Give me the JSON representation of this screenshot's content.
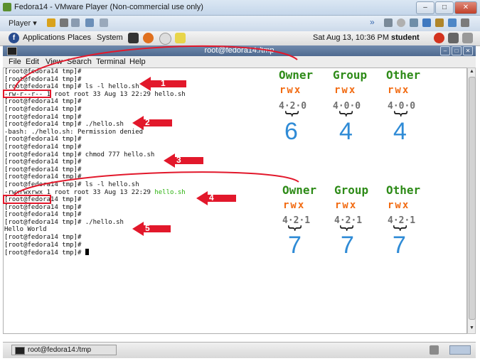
{
  "vm": {
    "title": "Fedora14 - VMware Player (Non-commercial use only)",
    "player": "Player",
    "player_caret": "▾"
  },
  "panel": {
    "applications": "Applications",
    "places": "Places",
    "system": "System",
    "clock": "Sat Aug 13, 10:36 PM",
    "user": "student"
  },
  "terminal": {
    "title": "root@fedora14:/tmp",
    "menu": [
      "File",
      "Edit",
      "View",
      "Search",
      "Terminal",
      "Help"
    ],
    "lines": [
      "[root@fedora14 tmp]#",
      "[root@fedora14 tmp]#",
      "[root@fedora14 tmp]# ls -l hello.sh",
      "-rw-r--r-- 1 root root 33 Aug 13 22:29 hello.sh",
      "[root@fedora14 tmp]#",
      "[root@fedora14 tmp]#",
      "[root@fedora14 tmp]#",
      "[root@fedora14 tmp]# ./hello.sh",
      "-bash: ./hello.sh: Permission denied",
      "[root@fedora14 tmp]#",
      "[root@fedora14 tmp]#",
      "[root@fedora14 tmp]# chmod 777 hello.sh",
      "[root@fedora14 tmp]#",
      "[root@fedora14 tmp]#",
      "[root@fedora14 tmp]#",
      "[root@fedora14 tmp]# ls -l hello.sh",
      "-rwxrwxrwx 1 root root 33 Aug 13 22:29 ",
      "[root@fedora14 tmp]#",
      "[root@fedora14 tmp]#",
      "[root@fedora14 tmp]#",
      "[root@fedora14 tmp]# ./hello.sh",
      "Hello World",
      "[root@fedora14 tmp]#",
      "[root@fedora14 tmp]#",
      "[root@fedora14 tmp]# "
    ],
    "green_filename": "hello.sh"
  },
  "annotations": {
    "headers": [
      "Owner",
      "Group",
      "Other"
    ],
    "rwx": "rwx",
    "before": {
      "bits": [
        "4·2·0",
        "4·0·0",
        "4·0·0"
      ],
      "values": [
        "6",
        "4",
        "4"
      ]
    },
    "after": {
      "bits": [
        "4·2·1",
        "4·2·1",
        "4·2·1"
      ],
      "values": [
        "7",
        "7",
        "7"
      ]
    },
    "arrows": [
      "1",
      "2",
      "3",
      "4",
      "5"
    ],
    "brace": "}"
  },
  "taskbar": {
    "item": "root@fedora14:/tmp"
  },
  "colors": {
    "green": "#2e8b18",
    "orange": "#f26b12",
    "blue": "#2f8bd6",
    "red": "#e2182b"
  }
}
